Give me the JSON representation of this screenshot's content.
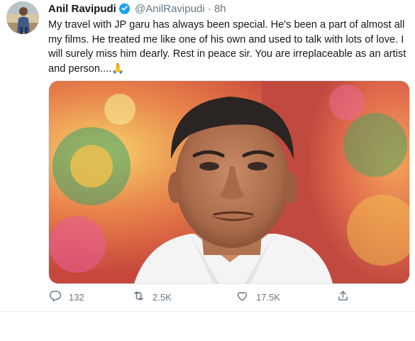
{
  "tweet": {
    "author_name": "Anil Ravipudi",
    "handle": "@AnilRavipudi",
    "separator": "·",
    "time": "8h",
    "text": "My travel with JP garu has always been special. He's been a part of almost all my films. He treated me like one of his own and used to talk with lots of love. I will surely miss him dearly. Rest in peace sir. You are irreplaceable as an artist and person....🙏",
    "verified_icon": "verified-badge-icon",
    "media_alt_icon": "photo"
  },
  "actions": {
    "reply_count": "132",
    "retweet_count": "2.5K",
    "like_count": "17.5K",
    "icons": [
      "reply-icon",
      "retweet-icon",
      "like-icon",
      "share-icon"
    ]
  },
  "colors": {
    "text": "#14171a",
    "secondary": "#657786",
    "verified": "#1da1f2"
  }
}
